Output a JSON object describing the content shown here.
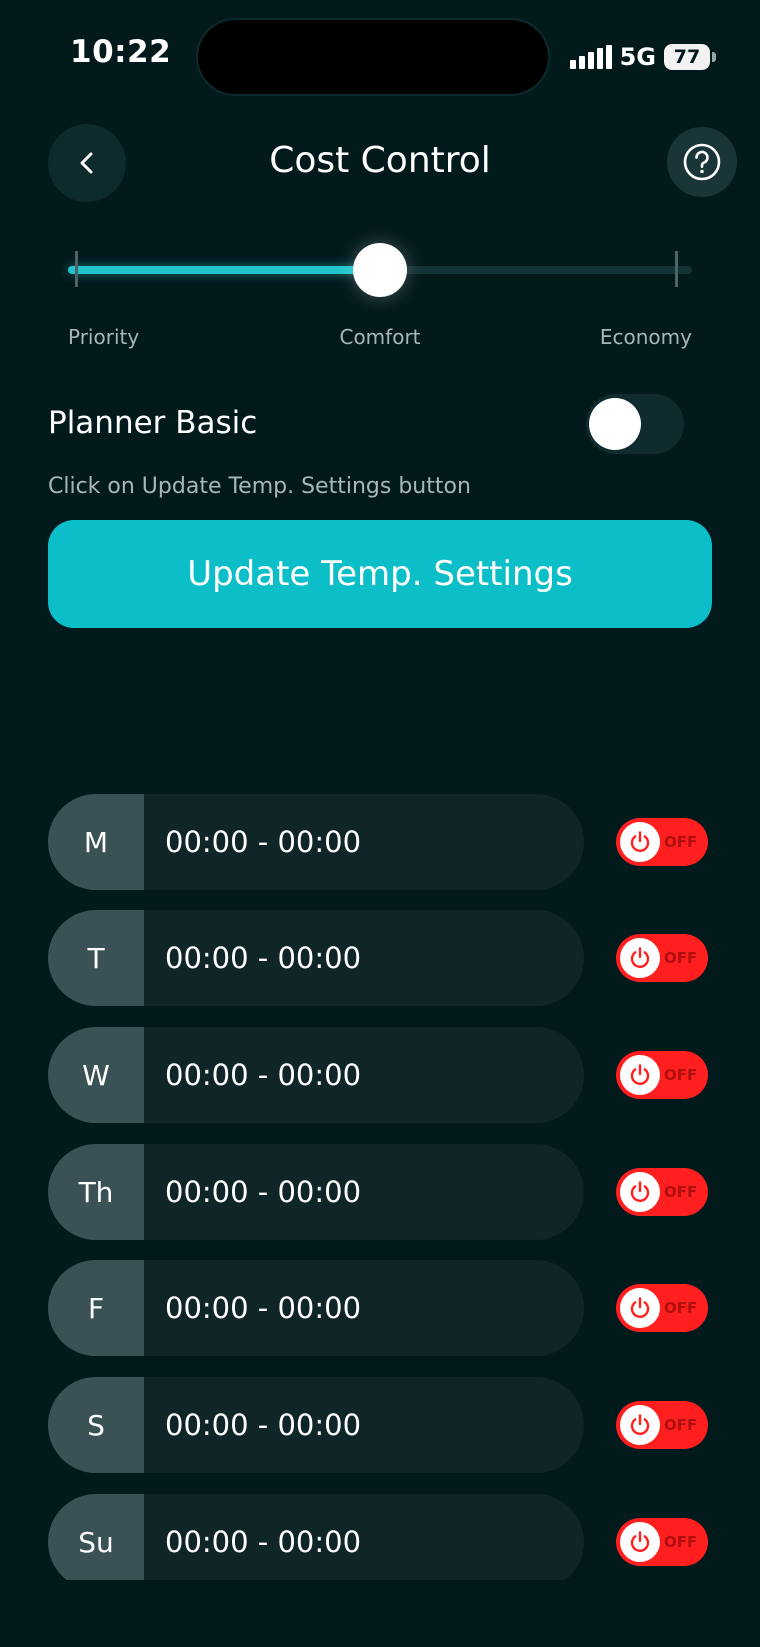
{
  "status_bar": {
    "time": "10:22",
    "network": "5G",
    "battery": "77"
  },
  "header": {
    "title": "Cost Control",
    "back_icon": "chevron-left-icon",
    "help_icon": "question-circle-icon"
  },
  "mode_slider": {
    "labels": [
      "Priority",
      "Comfort",
      "Economy"
    ],
    "selected": "Comfort",
    "value_fraction": 0.5,
    "accent_color": "#21c4cc"
  },
  "planner": {
    "label": "Planner Basic",
    "enabled": false,
    "hint": "Click on Update Temp. Settings button"
  },
  "update_button": {
    "label": "Update Temp. Settings",
    "color": "#0bbec7"
  },
  "schedule": {
    "toggle_icon": "power-icon",
    "toggle_color": "#ff1f1f",
    "days": [
      {
        "day": "M",
        "time": "00:00 - 00:00",
        "state": "OFF"
      },
      {
        "day": "T",
        "time": "00:00 - 00:00",
        "state": "OFF"
      },
      {
        "day": "W",
        "time": "00:00 - 00:00",
        "state": "OFF"
      },
      {
        "day": "Th",
        "time": "00:00 - 00:00",
        "state": "OFF"
      },
      {
        "day": "F",
        "time": "00:00 - 00:00",
        "state": "OFF"
      },
      {
        "day": "S",
        "time": "00:00 - 00:00",
        "state": "OFF"
      },
      {
        "day": "Su",
        "time": "00:00 - 00:00",
        "state": "OFF"
      }
    ]
  }
}
